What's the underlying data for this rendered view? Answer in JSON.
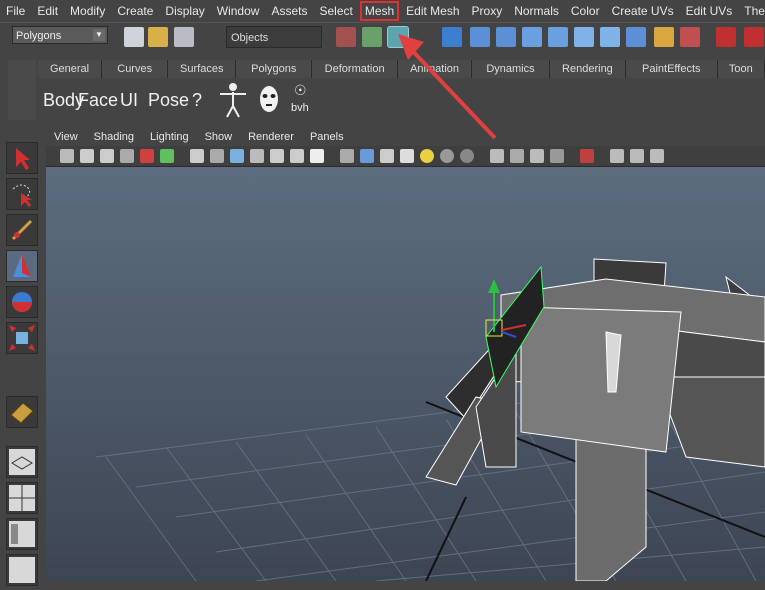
{
  "menubar": {
    "items": [
      {
        "label": "File"
      },
      {
        "label": "Edit"
      },
      {
        "label": "Modify"
      },
      {
        "label": "Create"
      },
      {
        "label": "Display"
      },
      {
        "label": "Window"
      },
      {
        "label": "Assets"
      },
      {
        "label": "Select"
      },
      {
        "label": "Mesh"
      },
      {
        "label": "Edit Mesh"
      },
      {
        "label": "Proxy"
      },
      {
        "label": "Normals"
      },
      {
        "label": "Color"
      },
      {
        "label": "Create UVs"
      },
      {
        "label": "Edit UVs"
      },
      {
        "label": "The Setup"
      }
    ],
    "highlighted": "Mesh"
  },
  "statusline": {
    "mode_value": "Polygons",
    "objects_value": "Objects"
  },
  "shelf": {
    "tabs": [
      "General",
      "Curves",
      "Surfaces",
      "Polygons",
      "Deformation",
      "Animation",
      "Dynamics",
      "Rendering",
      "PaintEffects",
      "Toon"
    ],
    "buttons": [
      "Body",
      "Face",
      "UI",
      "Pose",
      "?"
    ],
    "bvh_label": "bvh"
  },
  "panel": {
    "menu": [
      "View",
      "Shading",
      "Lighting",
      "Show",
      "Renderer",
      "Panels"
    ]
  },
  "colors": {
    "highlight": "#e03030",
    "arrow": "#e04040"
  }
}
